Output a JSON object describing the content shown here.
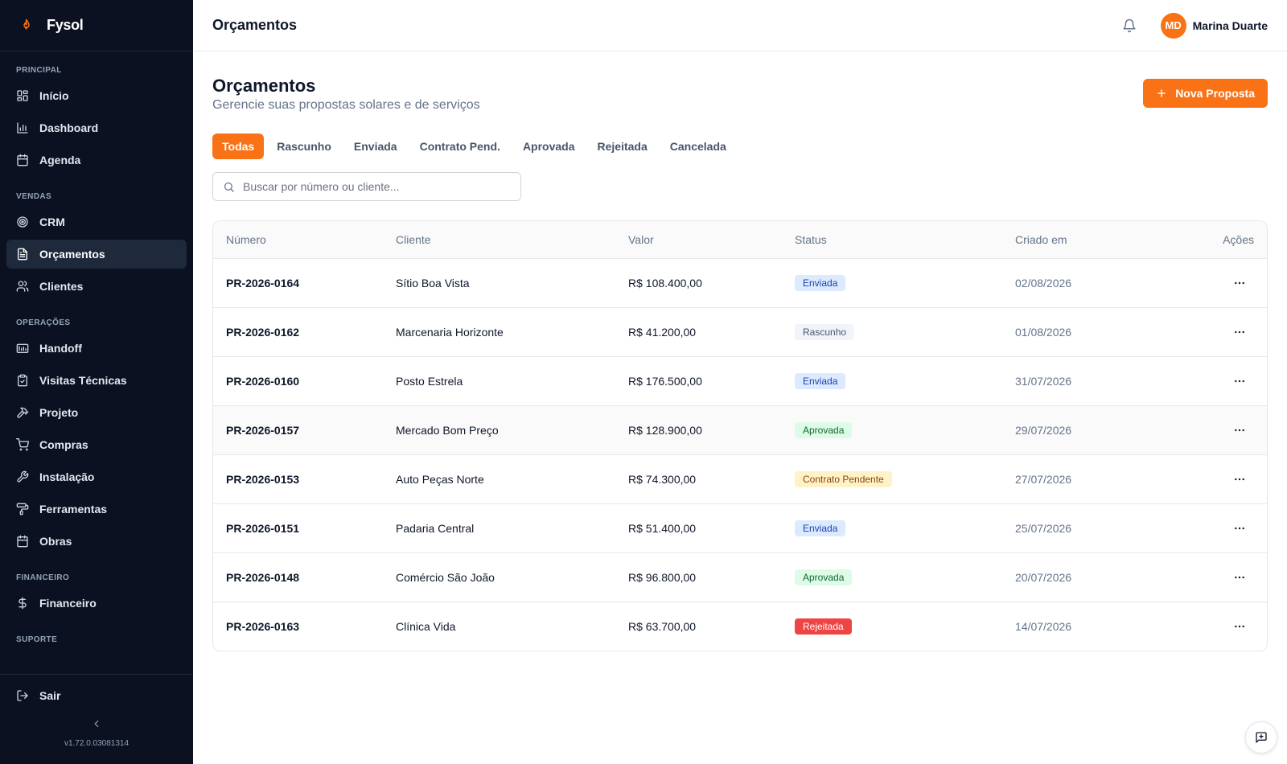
{
  "brand": {
    "name": "Fysol",
    "logo_icon": "flame-icon",
    "accent": "#f97316"
  },
  "sidebar": {
    "sections": [
      {
        "label": "PRINCIPAL",
        "items": [
          {
            "label": "Início",
            "icon": "grid-icon"
          },
          {
            "label": "Dashboard",
            "icon": "bar-chart-icon"
          },
          {
            "label": "Agenda",
            "icon": "calendar-icon"
          }
        ]
      },
      {
        "label": "VENDAS",
        "items": [
          {
            "label": "CRM",
            "icon": "target-icon"
          },
          {
            "label": "Orçamentos",
            "icon": "file-text-icon",
            "active": true
          },
          {
            "label": "Clientes",
            "icon": "users-icon"
          }
        ]
      },
      {
        "label": "OPERAÇÕES",
        "items": [
          {
            "label": "Handoff",
            "icon": "handoff-icon"
          },
          {
            "label": "Visitas Técnicas",
            "icon": "clipboard-check-icon"
          },
          {
            "label": "Projeto",
            "icon": "hammer-icon"
          },
          {
            "label": "Compras",
            "icon": "cart-icon"
          },
          {
            "label": "Instalação",
            "icon": "wrench-icon"
          },
          {
            "label": "Ferramentas",
            "icon": "paint-roller-icon"
          },
          {
            "label": "Obras",
            "icon": "calendar-icon"
          }
        ]
      },
      {
        "label": "FINANCEIRO",
        "items": [
          {
            "label": "Financeiro",
            "icon": "dollar-icon"
          }
        ]
      },
      {
        "label": "SUPORTE",
        "items": []
      }
    ],
    "logout_label": "Sair",
    "version": "v1.72.0.03081314"
  },
  "header": {
    "title": "Orçamentos",
    "user": {
      "initials": "MD",
      "name": "Marina Duarte"
    }
  },
  "page": {
    "title": "Orçamentos",
    "subtitle": "Gerencie suas propostas solares e de serviços",
    "new_button_label": "Nova Proposta"
  },
  "tabs": [
    {
      "label": "Todas",
      "active": true
    },
    {
      "label": "Rascunho"
    },
    {
      "label": "Enviada"
    },
    {
      "label": "Contrato Pend."
    },
    {
      "label": "Aprovada"
    },
    {
      "label": "Rejeitada"
    },
    {
      "label": "Cancelada"
    }
  ],
  "search": {
    "placeholder": "Buscar por número ou cliente...",
    "value": ""
  },
  "table": {
    "columns": [
      "Número",
      "Cliente",
      "Valor",
      "Status",
      "Criado em",
      "Ações"
    ],
    "rows": [
      {
        "numero": "PR-2026-0164",
        "cliente": "Sítio Boa Vista",
        "valor": "R$ 108.400,00",
        "status": "Enviada",
        "status_kind": "enviada",
        "criado": "02/08/2026"
      },
      {
        "numero": "PR-2026-0162",
        "cliente": "Marcenaria Horizonte",
        "valor": "R$ 41.200,00",
        "status": "Rascunho",
        "status_kind": "rascunho",
        "criado": "01/08/2026"
      },
      {
        "numero": "PR-2026-0160",
        "cliente": "Posto Estrela",
        "valor": "R$ 176.500,00",
        "status": "Enviada",
        "status_kind": "enviada",
        "criado": "31/07/2026"
      },
      {
        "numero": "PR-2026-0157",
        "cliente": "Mercado Bom Preço",
        "valor": "R$ 128.900,00",
        "status": "Aprovada",
        "status_kind": "aprovada",
        "criado": "29/07/2026",
        "hover": true
      },
      {
        "numero": "PR-2026-0153",
        "cliente": "Auto Peças Norte",
        "valor": "R$ 74.300,00",
        "status": "Contrato Pendente",
        "status_kind": "pendente",
        "criado": "27/07/2026"
      },
      {
        "numero": "PR-2026-0151",
        "cliente": "Padaria Central",
        "valor": "R$ 51.400,00",
        "status": "Enviada",
        "status_kind": "enviada",
        "criado": "25/07/2026"
      },
      {
        "numero": "PR-2026-0148",
        "cliente": "Comércio São João",
        "valor": "R$ 96.800,00",
        "status": "Aprovada",
        "status_kind": "aprovada",
        "criado": "20/07/2026"
      },
      {
        "numero": "PR-2026-0163",
        "cliente": "Clínica Vida",
        "valor": "R$ 63.700,00",
        "status": "Rejeitada",
        "status_kind": "rejeitada",
        "criado": "14/07/2026"
      }
    ]
  },
  "chat_button_icon": "message-square-plus-icon"
}
